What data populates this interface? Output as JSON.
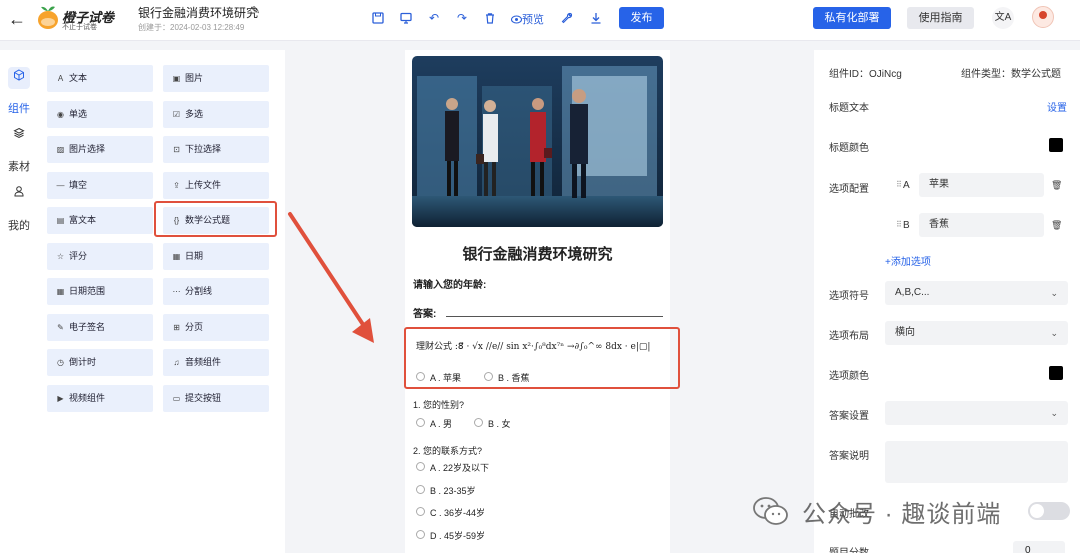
{
  "header": {
    "brand": "橙子试卷",
    "brand_sub": "不止于试卷",
    "title": "银行金融消费环境研究",
    "created": "创建于：2024-02-03 12:28:49",
    "preview": "预览",
    "publish": "发布",
    "private_deploy": "私有化部署",
    "guide": "使用指南",
    "lang_glyph": "文A"
  },
  "rail": [
    {
      "label": "组件"
    },
    {
      "label": "素材"
    },
    {
      "label": "我的"
    }
  ],
  "components": [
    {
      "label": "文本",
      "icon": "A"
    },
    {
      "label": "图片",
      "icon": "▣"
    },
    {
      "label": "单选",
      "icon": "◉"
    },
    {
      "label": "多选",
      "icon": "☑"
    },
    {
      "label": "图片选择",
      "icon": "▨"
    },
    {
      "label": "下拉选择",
      "icon": "⊡"
    },
    {
      "label": "填空",
      "icon": "—"
    },
    {
      "label": "上传文件",
      "icon": "⇪"
    },
    {
      "label": "富文本",
      "icon": "▤"
    },
    {
      "label": "数学公式题",
      "icon": "{}"
    },
    {
      "label": "评分",
      "icon": "☆"
    },
    {
      "label": "日期",
      "icon": "▦"
    },
    {
      "label": "日期范围",
      "icon": "▦"
    },
    {
      "label": "分割线",
      "icon": "⋯"
    },
    {
      "label": "电子签名",
      "icon": "✎"
    },
    {
      "label": "分页",
      "icon": "⊞"
    },
    {
      "label": "倒计时",
      "icon": "◷"
    },
    {
      "label": "音频组件",
      "icon": "♫"
    },
    {
      "label": "视频组件",
      "icon": "▶"
    },
    {
      "label": "提交按钮",
      "icon": "▭"
    }
  ],
  "form": {
    "title": "银行金融消费环境研究",
    "q_age": "请输入您的年龄:",
    "answer": "答案:",
    "formula": "理财公式 :8⃗ · √x //e// sin x²·∫₀⁸dx⁷ⁿ →∂∫₀^∞ 8dx · e|▢|",
    "formula_opts": [
      "A . 苹果",
      "B . 香蕉"
    ],
    "q1": "1. 您的性别?",
    "q1_opts": [
      "A . 男",
      "B . 女"
    ],
    "q2": "2. 您的联系方式?",
    "q2_opts": [
      "A . 22岁及以下",
      "B . 23-35岁",
      "C . 36岁-44岁",
      "D . 45岁-59岁"
    ]
  },
  "props": {
    "comp_id": "组件ID：OJiNcg",
    "comp_type": "组件类型：数学公式题",
    "title_text": "标题文本",
    "set": "设置",
    "title_color": "标题颜色",
    "option_config": "选项配置",
    "options": [
      {
        "key": "A",
        "value": "苹果"
      },
      {
        "key": "B",
        "value": "香蕉"
      }
    ],
    "add_option": "+添加选项",
    "option_symbol": "选项符号",
    "option_symbol_value": "A,B,C...",
    "option_layout": "选项布局",
    "option_layout_value": "横向",
    "option_color": "选项颜色",
    "answer_setting": "答案设置",
    "answer_setting_value": "",
    "answer_desc": "答案说明",
    "auto_grade": "自动批改",
    "score": "题目分数",
    "score_value": "0",
    "swatch_color": "#000000"
  },
  "watermark": "公众号 · 趣谈前端"
}
